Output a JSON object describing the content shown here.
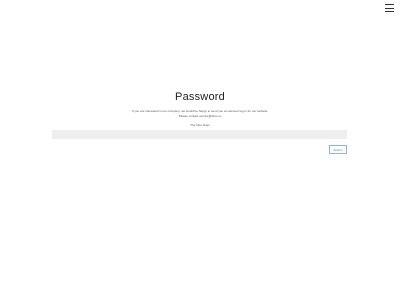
{
  "header": {
    "menu_icon": "hamburger-menu-icon"
  },
  "main": {
    "title": "Password",
    "message_line1": "If you are interested in our company, we would be happy to send you an account log in for our website.",
    "message_line2": "Please contact service@idxo.co",
    "signature": "The Idxo Team",
    "password_placeholder": "",
    "submit_label": "Submit"
  },
  "colors": {
    "input_background": "#eeeeee",
    "button_border": "#8fb8d8",
    "button_text": "#4a8ab8"
  }
}
